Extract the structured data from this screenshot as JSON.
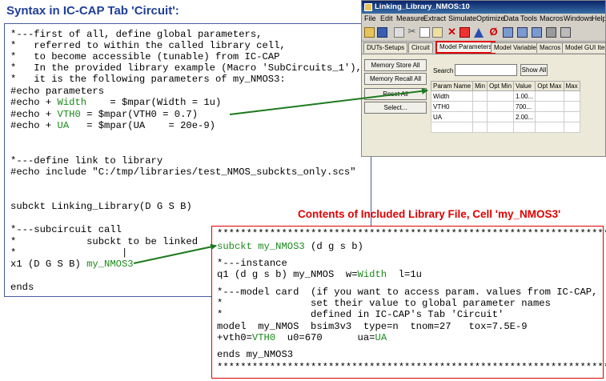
{
  "left_title": "Syntax in IC-CAP Tab 'Circuit':",
  "right_title": "Contents of Included Library File, Cell  'my_NMOS3'",
  "circuit_code": {
    "l1": "*---first of all, define global parameters,",
    "l2": "*   referred to within the called library cell,",
    "l3": "*   to become accessible (tunable) from IC-CAP",
    "l4": "*   In the provided library example (Macro 'SubCircuits_1'),",
    "l5": "*   it is the following parameters of my_NMOS3:",
    "l6": "#echo parameters",
    "l7a": "#echo + ",
    "l7b": "Width",
    "l7c": "    = $mpar(Width = 1u)",
    "l8a": "#echo + ",
    "l8b": "VTH0",
    "l8c": " = $mpar(VTH0 = 0.7)",
    "l9a": "#echo + ",
    "l9b": "UA",
    "l9c": "   = $mpar(UA    = 20e-9)",
    "l10": "*---define link to library",
    "l11": "#echo include \"C:/tmp/libraries/test_NMOS_subckts_only.scs\"",
    "l12": "subckt Linking_Library(D G S B)",
    "l13": "*---subcircuit call",
    "l14": "*            subckt to be linked",
    "l15": "*                  |",
    "l16a": "x1 (D G S B) ",
    "l16b": "my_NMOS3",
    "l17": "ends"
  },
  "library_code": {
    "stars": "********************************************************************",
    "l1a": "subckt my_NMOS3",
    "l1b": " (d g s b)",
    "l2": "*---instance",
    "l3a": "q1 (d g s b) my_NMOS  w=",
    "l3b": "Width",
    "l3c": "  l=1u",
    "l4": "*---model card  (if you want to access param. values from IC-CAP,",
    "l5": "*               set their value to global parameter names",
    "l6": "*               defined in IC-CAP's Tab 'Circuit'",
    "l7": "model  my_NMOS  bsim3v3  type=n  tnom=27   tox=7.5E-9",
    "l8a": "+vth0=",
    "l8b": "VTH0",
    "l8c": "  u0=670      ua=",
    "l8d": "UA",
    "l9": "ends my_NMOS3"
  },
  "iccap": {
    "window_title": "Linking_Library_NMOS:10",
    "menu": [
      "File",
      "Edit",
      "Measure",
      "Extract",
      "Simulate",
      "Optimize",
      "Data",
      "Tools",
      "Macros",
      "Windows",
      "Help"
    ],
    "tabs": [
      "DUTs-Setups",
      "Circuit",
      "Model Parameters",
      "Model Variables",
      "Macros",
      "Model GUI Item"
    ],
    "buttons": {
      "memory_store": "Memory Store All",
      "memory_recall": "Memory Recall All",
      "reset": "Reset All",
      "select": "Select...",
      "show_all": "Show All"
    },
    "search_label": "Search",
    "table_headers": [
      "Param Name",
      "Min",
      "Opt Min",
      "Value",
      "Opt Max",
      "Max"
    ],
    "rows": [
      {
        "name": "Width",
        "value": "1.00..."
      },
      {
        "name": "VTH0",
        "value": "700..."
      },
      {
        "name": "UA",
        "value": "2.00..."
      }
    ]
  },
  "colors": {
    "title_blue": "#1f3f99",
    "title_red": "#e00000",
    "param_green": "#1a8a1a",
    "arrow_green": "#1e7a1e"
  }
}
